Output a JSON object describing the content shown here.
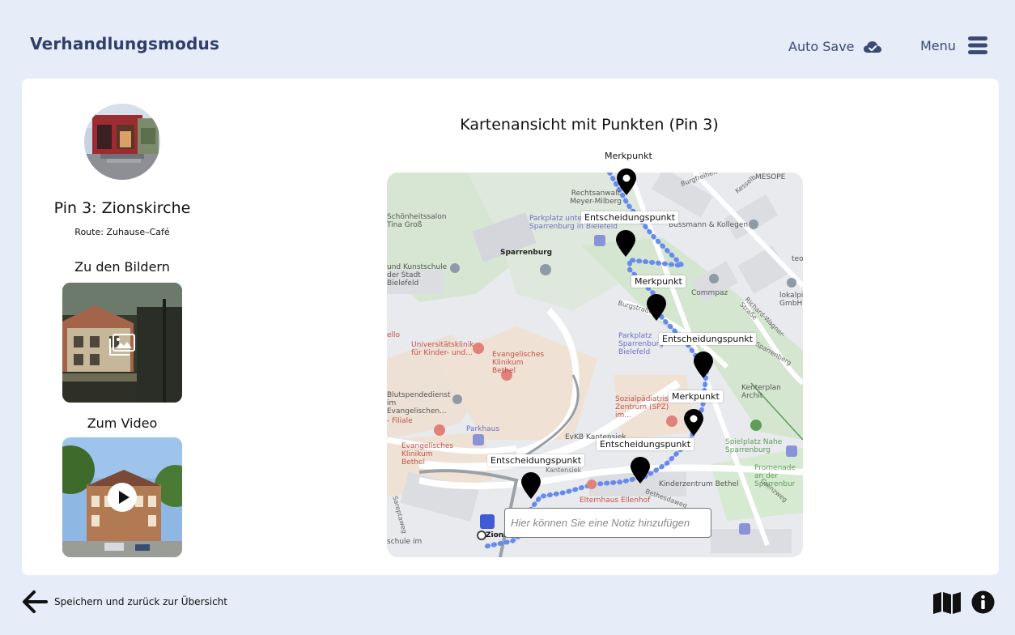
{
  "header": {
    "title": "Verhandlungsmodus",
    "autosave_label": "Auto Save",
    "autosave_icon": "cloud-check-icon",
    "menu_label": "Menu",
    "menu_icon": "hamburger-icon"
  },
  "sidebar": {
    "pin_title": "Pin 3: Zionskirche",
    "route": "Route: Zuhause–Café",
    "images_title": "Zu den Bildern",
    "video_title": "Zum Video"
  },
  "map": {
    "title": "Kartenansicht mit Punkten (Pin 3)",
    "markers": [
      {
        "label": "Merkpunkt"
      },
      {
        "label": "Entscheidungspunkt"
      },
      {
        "label": "Merkpunkt"
      },
      {
        "label": "Entscheidungspunkt"
      },
      {
        "label": "Merkpunkt"
      },
      {
        "label": "Entscheidungspunkt"
      },
      {
        "label": "Entscheidungspunkt"
      }
    ],
    "place_labels": {
      "sparrenburg": "Sparrenburg",
      "rechtsanwalt": "Rechtsanwalt Meyer-Milberg",
      "mesope": "MESOPE",
      "bussmann": "Bussmann & Kollegen",
      "parkplatz1": "Parkplatz unter der Sparrenburg in Bielefeld",
      "schoenheit": "Schönheitssalon Tina Groß",
      "kunstschule": "und Kunstschule der Stadt Bielefeld",
      "commpaz": "Commpaz",
      "lokalp": "lokalpi GmbH",
      "parkplatz2": "Parkplatz Sparrenburg Bielefeld",
      "uniklinik": "Universitätsklinik für Kinder- und...",
      "evklinikum": "Evangelisches Klinikum Bethel",
      "blutspende": "Blutspendedienst im Evangelischen...",
      "spz": "Sozialpädiatrisches Zentrum (SPZ) im...",
      "kenterplan": "Kenterplan Archit",
      "spielplatz": "Spielplatz Nahe Sparrenburg",
      "parkhaus": "Parkhaus",
      "evkb": "EvKB Kantensiek",
      "evklinikum2": "Evangelisches Klinikum Bethel",
      "kinderzentrum": "Kinderzentrum Bethel",
      "promenade": "Promenade an der Sparrenbur",
      "elternhaus": "Elternhaus Ellenhof",
      "zions": "Zions",
      "schule": "schule im",
      "filiale": "- Filiale",
      "kantensiek": "Kantensiek",
      "burgstr": "Burgstraße",
      "amsparrenberg": "Am Sparrenberg",
      "richardwagner": "Richard-Wagner-Straße",
      "kesselbrink": "Kesselb",
      "grenzweg": "Grenzweg",
      "bethesdaweg": "Bethesdaweg",
      "sareptaweg": "Sareptaweg",
      "burgfreiheit": "Burgfreiheit",
      "ello": "ello",
      "teo": "teo"
    },
    "note_placeholder": "Hier können Sie eine Notiz hinzufügen"
  },
  "footer": {
    "back_label": "Speichern und zurück zur Übersicht",
    "back_icon": "arrow-left-icon",
    "map_icon": "map-icon",
    "info_icon": "info-icon"
  },
  "colors": {
    "background": "#e6ecf8",
    "title": "#2f3e6b",
    "route": "#6b8ef0",
    "marker": "#000000"
  }
}
